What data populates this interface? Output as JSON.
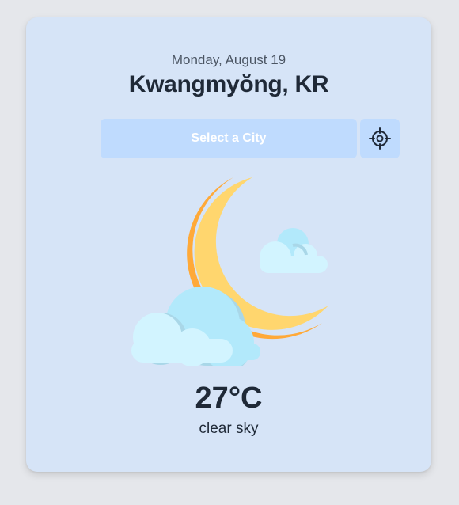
{
  "date": "Monday, August 19",
  "location": "Kwangmyŏng, KR",
  "city_select": {
    "placeholder": "Select a City"
  },
  "locate_button": {
    "icon": "crosshair-icon"
  },
  "weather": {
    "icon": "moon-with-clouds-icon",
    "temperature": "27°C",
    "description": "clear sky"
  },
  "colors": {
    "page_background": "#e5e7eb",
    "card_background": "#d6e4f7",
    "button_background": "#bfdbfe",
    "moon_yellow": "#ffd66e",
    "moon_orange": "#ffa938",
    "cloud_light": "#d2f4ff",
    "cloud_blue": "#b2e9fb"
  }
}
